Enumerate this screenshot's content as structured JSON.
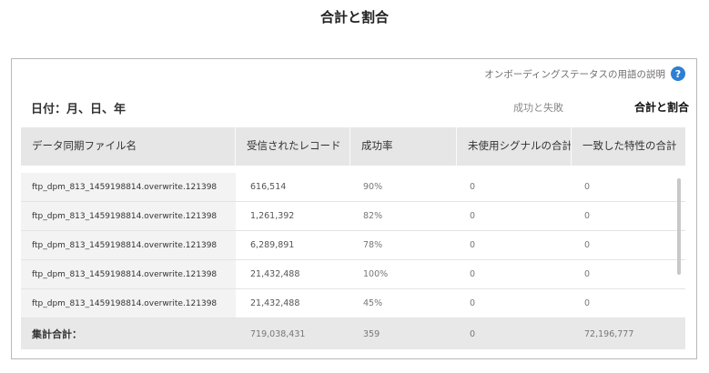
{
  "page": {
    "title": "合計と割合"
  },
  "panel": {
    "help_link": "オンボーディングステータスの用語の説明",
    "help_icon": "?",
    "date_label": "日付：月、日、年",
    "tabs": [
      {
        "label": "成功と失敗",
        "active": false
      },
      {
        "label": "合計と割合",
        "active": true
      }
    ]
  },
  "table": {
    "columns": [
      "データ同期ファイル名",
      "受信されたレコード",
      "成功率",
      "未使用シグナルの合計",
      "一致した特性の合計"
    ],
    "rows": [
      {
        "file": "ftp_dpm_813_1459198814.overwrite.121398",
        "records": "616,514",
        "success": "90%",
        "unused": "0",
        "matched": "0"
      },
      {
        "file": "ftp_dpm_813_1459198814.overwrite.121398",
        "records": "1,261,392",
        "success": "82%",
        "unused": "0",
        "matched": "0"
      },
      {
        "file": "ftp_dpm_813_1459198814.overwrite.121398",
        "records": "6,289,891",
        "success": "78%",
        "unused": "0",
        "matched": "0"
      },
      {
        "file": "ftp_dpm_813_1459198814.overwrite.121398",
        "records": "21,432,488",
        "success": "100%",
        "unused": "0",
        "matched": "0"
      },
      {
        "file": "ftp_dpm_813_1459198814.overwrite.121398",
        "records": "21,432,488",
        "success": "45%",
        "unused": "0",
        "matched": "0"
      }
    ],
    "total": {
      "label": "集計合計：",
      "records": "719,038,431",
      "success": "359",
      "unused": "0",
      "matched": "72,196,777"
    }
  },
  "colors": {
    "help_icon": "#2d7fd3",
    "header_bg": "#e6e6e6",
    "total_bg": "#e8e8e8"
  }
}
